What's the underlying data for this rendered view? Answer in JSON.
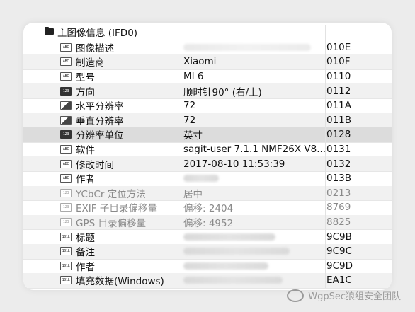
{
  "section": {
    "label": "主图像信息 (IFD0)"
  },
  "rows": [
    {
      "name": "图像描述",
      "value": "",
      "tag": "010E",
      "icon": "abc-icon"
    },
    {
      "name": "制造商",
      "value": "Xiaomi",
      "tag": "010F",
      "icon": "abc-icon"
    },
    {
      "name": "型号",
      "value": "MI 6",
      "tag": "0110",
      "icon": "abc-icon"
    },
    {
      "name": "方向",
      "value": "顺时针90° (右/上)",
      "tag": "0112",
      "icon": "123-icon"
    },
    {
      "name": "水平分辨率",
      "value": "72",
      "tag": "011A",
      "icon": "ratio-icon"
    },
    {
      "name": "垂直分辨率",
      "value": "72",
      "tag": "011B",
      "icon": "ratio-icon"
    },
    {
      "name": "分辨率单位",
      "value": "英寸",
      "tag": "0128",
      "icon": "123-icon"
    },
    {
      "name": "软件",
      "value": "sagit-user 7.1.1 NMF26X V8....",
      "tag": "0131",
      "icon": "abc-icon"
    },
    {
      "name": "修改时间",
      "value": "2017-08-10 11:53:39",
      "tag": "0132",
      "icon": "abc-icon"
    },
    {
      "name": "作者",
      "value": "",
      "tag": "013B",
      "icon": "abc-icon"
    },
    {
      "name": "YCbCr 定位方法",
      "value": "居中",
      "tag": "0213",
      "icon": "123-icon"
    },
    {
      "name": "EXIF 子目录偏移量",
      "value": "偏移: 2404",
      "tag": "8769",
      "icon": "123-icon"
    },
    {
      "name": "GPS 目录偏移量",
      "value": "偏移: 4952",
      "tag": "8825",
      "icon": "123-icon"
    },
    {
      "name": "标题",
      "value": "",
      "tag": "9C9B",
      "icon": "bytes-icon"
    },
    {
      "name": "备注",
      "value": "",
      "tag": "9C9C",
      "icon": "bytes-icon"
    },
    {
      "name": "作者",
      "value": "",
      "tag": "9C9D",
      "icon": "bytes-icon"
    },
    {
      "name": "填充数据(Windows)",
      "value": "",
      "tag": "EA1C",
      "icon": "bytes-icon"
    }
  ],
  "watermark": {
    "text": "WgpSec狼组安全团队"
  }
}
